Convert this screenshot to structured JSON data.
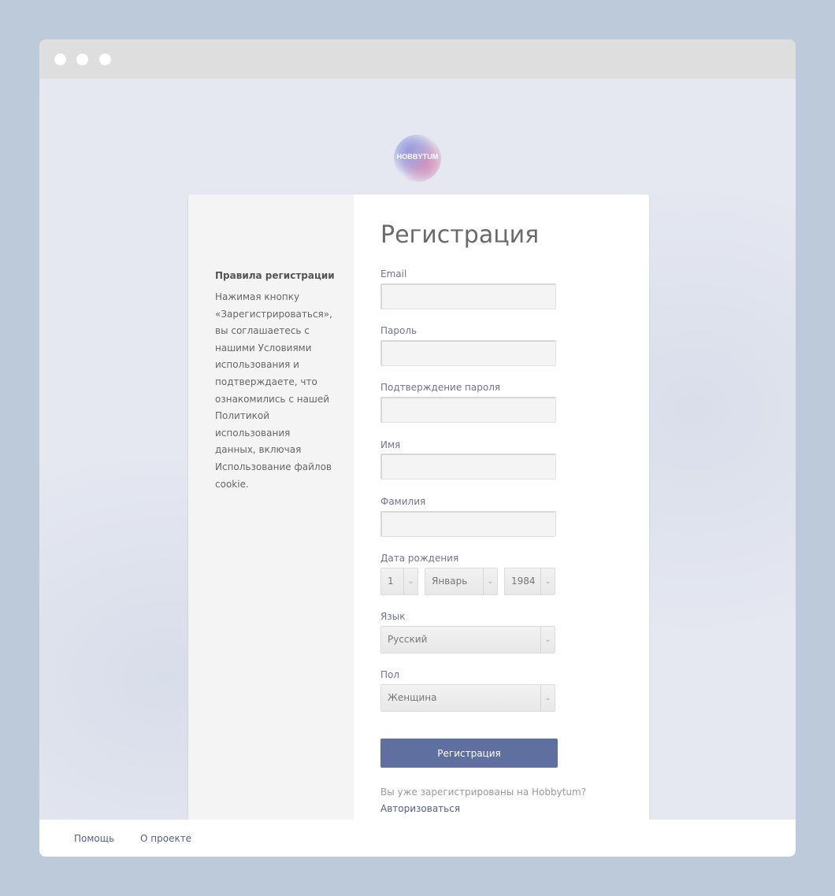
{
  "window": {
    "controls": [
      "close",
      "minimize",
      "maximize"
    ]
  },
  "logo": {
    "text": "HOBBYTUM"
  },
  "sidebar": {
    "title": "Правила регистрации",
    "text": "Нажимая кнопку «Зарегистрироваться», вы соглашаетесь с нашими Условиями использования и подтверждаете, что ознакомились с нашей Политикой использования данных, включая Использование файлов cookie."
  },
  "form": {
    "title": "Регистрация",
    "email": {
      "label": "Email",
      "value": ""
    },
    "password": {
      "label": "Пароль",
      "value": ""
    },
    "password_confirm": {
      "label": "Подтверждение пароля",
      "value": ""
    },
    "first_name": {
      "label": "Имя",
      "value": ""
    },
    "last_name": {
      "label": "Фамилия",
      "value": ""
    },
    "birth_date": {
      "label": "Дата рождения",
      "day": "1",
      "month": "Январь",
      "year": "1984"
    },
    "language": {
      "label": "Язык",
      "value": "Русский"
    },
    "gender": {
      "label": "Пол",
      "value": "Женщина"
    },
    "submit_label": "Регистрация",
    "already_registered": "Вы уже зарегистрированы на Hobbytum?",
    "login_link": "Авторизоваться"
  },
  "footer": {
    "help": "Помощь",
    "about": "О проекте"
  },
  "colors": {
    "page_background": "#bccada",
    "primary_button": "#5f6f9f",
    "link": "#555d85"
  },
  "icons": {
    "select_arrow": "chevron-down-icon"
  }
}
